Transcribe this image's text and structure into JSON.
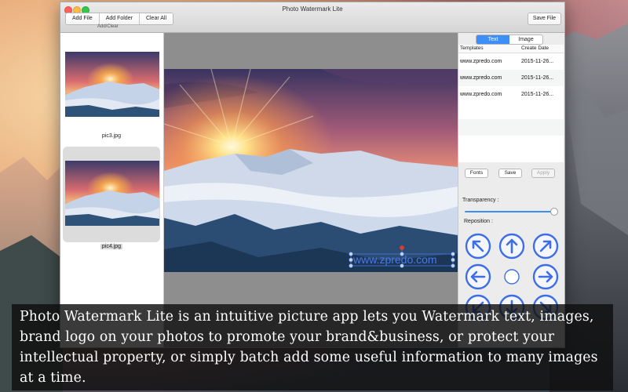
{
  "window": {
    "title": "Photo Watermark Lite"
  },
  "toolbar": {
    "add_file": "Add File",
    "add_folder": "Add Folder",
    "clear_all": "Clear All",
    "group_label": "Add/Clear",
    "save_file": "Save File"
  },
  "thumbnails": [
    {
      "label": "pic3.jpg"
    },
    {
      "label": "pic4.jpg"
    }
  ],
  "preview": {
    "watermark_text": "www.zpredo.com"
  },
  "right_panel": {
    "tabs": [
      {
        "label": "Text",
        "active": true
      },
      {
        "label": "Image",
        "active": false
      }
    ],
    "templates_header": "Templates",
    "create_date_header": "Create Date",
    "templates": [
      {
        "name": "www.zpredo.com",
        "date": "2015-11-26..."
      },
      {
        "name": "www.zpredo.com",
        "date": "2015-11-26..."
      },
      {
        "name": "www.zpredo.com",
        "date": "2015-11-26..."
      }
    ],
    "fonts_button": "Fonts",
    "save_button": "Save",
    "apply_button": "Apply",
    "transparency_label": "Transparency :",
    "transparency_value": 0.97,
    "reposition_label": "Reposition :",
    "reposition_icons": [
      "arrow-up-left-icon",
      "arrow-up-icon",
      "arrow-up-right-icon",
      "arrow-left-icon",
      "center-circle-icon",
      "arrow-right-icon",
      "arrow-down-left-icon",
      "arrow-down-icon",
      "arrow-down-right-icon"
    ]
  },
  "caption": {
    "text": "Photo Watermark Lite is an intuitive picture app lets you Watermark text, images, brand logo on your photos to promote your brand&business, or protect your intellectual property, or simply batch add some useful information to many images at a time."
  },
  "colors": {
    "accent": "#3e8ef7",
    "watermark": "#4a78e8",
    "arrow_blue": "#3d6ee8"
  }
}
